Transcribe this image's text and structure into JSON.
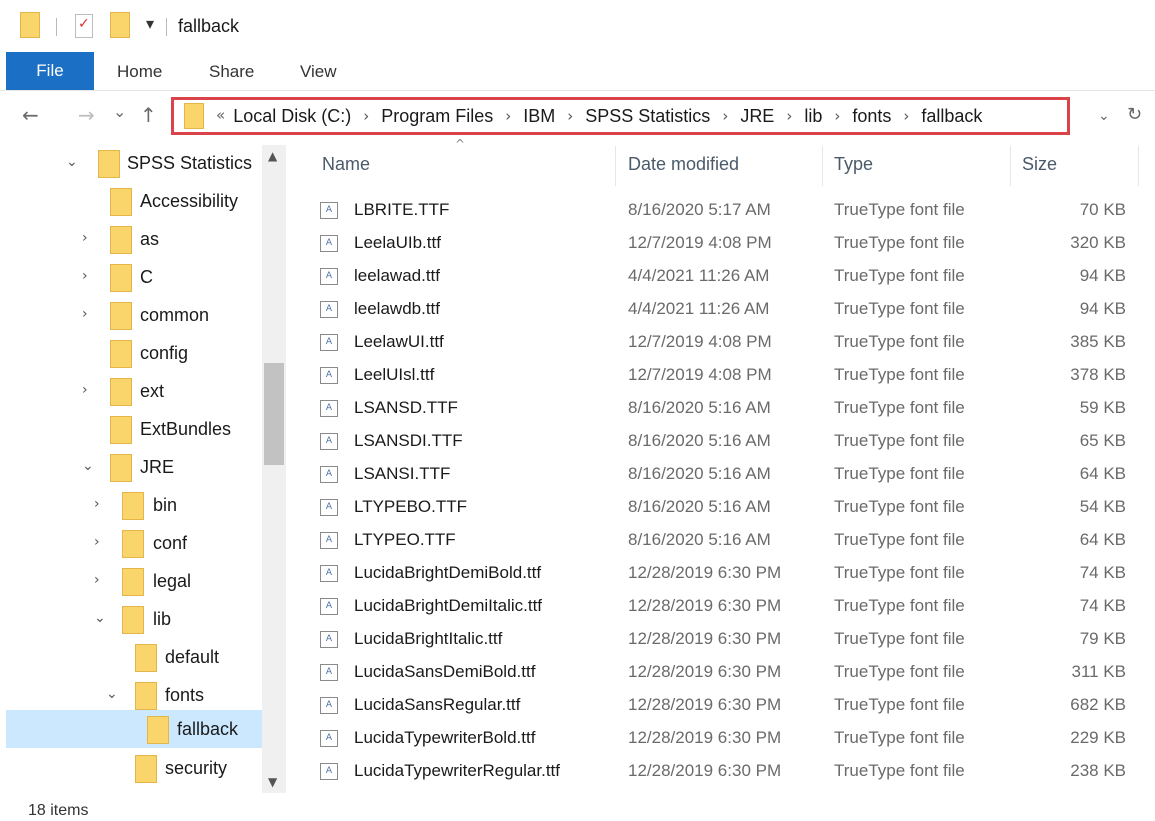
{
  "window": {
    "title": "fallback"
  },
  "ribbon": {
    "tabs": [
      "File",
      "Home",
      "Share",
      "View"
    ]
  },
  "nav": {
    "back": "←",
    "forward": "→",
    "recent": "⌄",
    "up": "↑",
    "address_overflow": "«",
    "breadcrumbs": [
      "Local Disk (C:)",
      "Program Files",
      "IBM",
      "SPSS Statistics",
      "JRE",
      "lib",
      "fonts",
      "fallback"
    ],
    "crumb_separator": "›",
    "address_dropdown": "⌄",
    "refresh": "↻"
  },
  "tree": {
    "items": [
      {
        "label": "SPSS Statistics",
        "chevron": "⌄"
      },
      {
        "label": "Accessibility",
        "chevron": ""
      },
      {
        "label": "as",
        "chevron": "›"
      },
      {
        "label": "C",
        "chevron": "›"
      },
      {
        "label": "common",
        "chevron": "›"
      },
      {
        "label": "config",
        "chevron": ""
      },
      {
        "label": "ext",
        "chevron": "›"
      },
      {
        "label": "ExtBundles",
        "chevron": ""
      },
      {
        "label": "JRE",
        "chevron": "⌄"
      },
      {
        "label": "bin",
        "chevron": "›"
      },
      {
        "label": "conf",
        "chevron": "›"
      },
      {
        "label": "legal",
        "chevron": "›"
      },
      {
        "label": "lib",
        "chevron": "⌄"
      },
      {
        "label": "default",
        "chevron": ""
      },
      {
        "label": "fonts",
        "chevron": "⌄"
      },
      {
        "label": "fallback",
        "chevron": ""
      },
      {
        "label": "security",
        "chevron": ""
      }
    ]
  },
  "columns": {
    "name": "Name",
    "date": "Date modified",
    "type": "Type",
    "size": "Size"
  },
  "files": [
    {
      "name": "LBRITE.TTF",
      "date": "8/16/2020 5:17 AM",
      "type": "TrueType font file",
      "size": "70 KB"
    },
    {
      "name": "LeelaUIb.ttf",
      "date": "12/7/2019 4:08 PM",
      "type": "TrueType font file",
      "size": "320 KB"
    },
    {
      "name": "leelawad.ttf",
      "date": "4/4/2021 11:26 AM",
      "type": "TrueType font file",
      "size": "94 KB"
    },
    {
      "name": "leelawdb.ttf",
      "date": "4/4/2021 11:26 AM",
      "type": "TrueType font file",
      "size": "94 KB"
    },
    {
      "name": "LeelawUI.ttf",
      "date": "12/7/2019 4:08 PM",
      "type": "TrueType font file",
      "size": "385 KB"
    },
    {
      "name": "LeelUIsl.ttf",
      "date": "12/7/2019 4:08 PM",
      "type": "TrueType font file",
      "size": "378 KB"
    },
    {
      "name": "LSANSD.TTF",
      "date": "8/16/2020 5:16 AM",
      "type": "TrueType font file",
      "size": "59 KB"
    },
    {
      "name": "LSANSDI.TTF",
      "date": "8/16/2020 5:16 AM",
      "type": "TrueType font file",
      "size": "65 KB"
    },
    {
      "name": "LSANSI.TTF",
      "date": "8/16/2020 5:16 AM",
      "type": "TrueType font file",
      "size": "64 KB"
    },
    {
      "name": "LTYPEBO.TTF",
      "date": "8/16/2020 5:16 AM",
      "type": "TrueType font file",
      "size": "54 KB"
    },
    {
      "name": "LTYPEO.TTF",
      "date": "8/16/2020 5:16 AM",
      "type": "TrueType font file",
      "size": "64 KB"
    },
    {
      "name": "LucidaBrightDemiBold.ttf",
      "date": "12/28/2019 6:30 PM",
      "type": "TrueType font file",
      "size": "74 KB"
    },
    {
      "name": "LucidaBrightDemiItalic.ttf",
      "date": "12/28/2019 6:30 PM",
      "type": "TrueType font file",
      "size": "74 KB"
    },
    {
      "name": "LucidaBrightItalic.ttf",
      "date": "12/28/2019 6:30 PM",
      "type": "TrueType font file",
      "size": "79 KB"
    },
    {
      "name": "LucidaSansDemiBold.ttf",
      "date": "12/28/2019 6:30 PM",
      "type": "TrueType font file",
      "size": "311 KB"
    },
    {
      "name": "LucidaSansRegular.ttf",
      "date": "12/28/2019 6:30 PM",
      "type": "TrueType font file",
      "size": "682 KB"
    },
    {
      "name": "LucidaTypewriterBold.ttf",
      "date": "12/28/2019 6:30 PM",
      "type": "TrueType font file",
      "size": "229 KB"
    },
    {
      "name": "LucidaTypewriterRegular.ttf",
      "date": "12/28/2019 6:30 PM",
      "type": "TrueType font file",
      "size": "238 KB"
    }
  ],
  "status": {
    "item_count": "18 items"
  },
  "colors": {
    "accent": "#1b6fc4",
    "address_highlight": "#d9434a",
    "folder": "#f9d56c",
    "selection": "#cce8ff"
  }
}
